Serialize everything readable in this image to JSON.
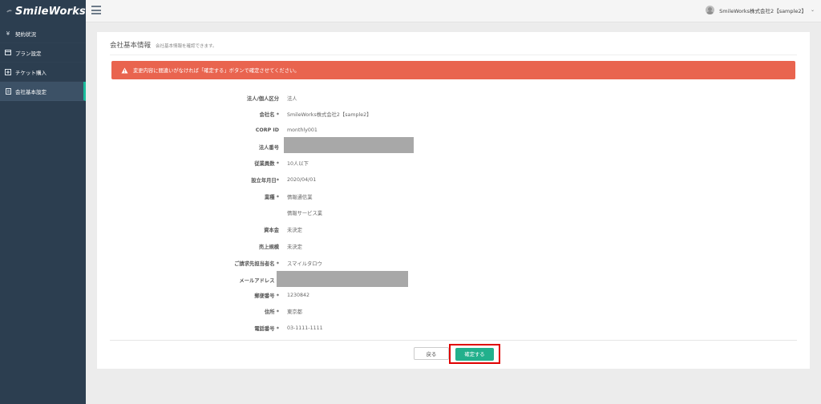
{
  "brand": {
    "name": "SmileWorks"
  },
  "sidebar": {
    "items": [
      {
        "label": "契約状況",
        "icon": "yen-icon"
      },
      {
        "label": "プラン設定",
        "icon": "card-icon"
      },
      {
        "label": "チケット購入",
        "icon": "plus-box-icon"
      },
      {
        "label": "会社基本設定",
        "icon": "document-icon",
        "active": true
      }
    ]
  },
  "header": {
    "user_label": "SmileWorks株式会社2【sample2】"
  },
  "page": {
    "title": "会社基本情報",
    "subtitle": "会社基本情報を確認できます。",
    "alert": "変更内容に間違いがなければ「確定する」ボタンで確定させてください。"
  },
  "form": {
    "rows": [
      {
        "label": "法人/個人区分",
        "value": "法人"
      },
      {
        "label": "会社名 *",
        "value": "SmileWorks株式会社2【sample2】"
      },
      {
        "label": "CORP ID",
        "value": "monthly001"
      },
      {
        "label": "法人番号",
        "value": ""
      },
      {
        "label": "従業員数 *",
        "value": "10人以下"
      },
      {
        "label": "設立年月日*",
        "value": "2020/04/01"
      },
      {
        "label": "業種 *",
        "value": "情報通信業"
      },
      {
        "label": "",
        "value": "情報サービス業"
      },
      {
        "label": "資本金",
        "value": "未決定"
      },
      {
        "label": "売上規模",
        "value": "未決定"
      },
      {
        "label": "ご請求先担当者名 *",
        "value": "スマイルタロウ"
      },
      {
        "label": "メールアドレス *",
        "value": ""
      },
      {
        "label": "郵便番号 *",
        "value": "1230842"
      },
      {
        "label": "住所 *",
        "value": "東京都"
      },
      {
        "label": "電話番号 *",
        "value": "03-1111-1111"
      }
    ]
  },
  "actions": {
    "back_label": "戻る",
    "confirm_label": "確定する"
  },
  "colors": {
    "sidebar": "#2c3e50",
    "alert": "#e9644f",
    "confirm": "#22b08c",
    "highlight": "#e00000"
  }
}
